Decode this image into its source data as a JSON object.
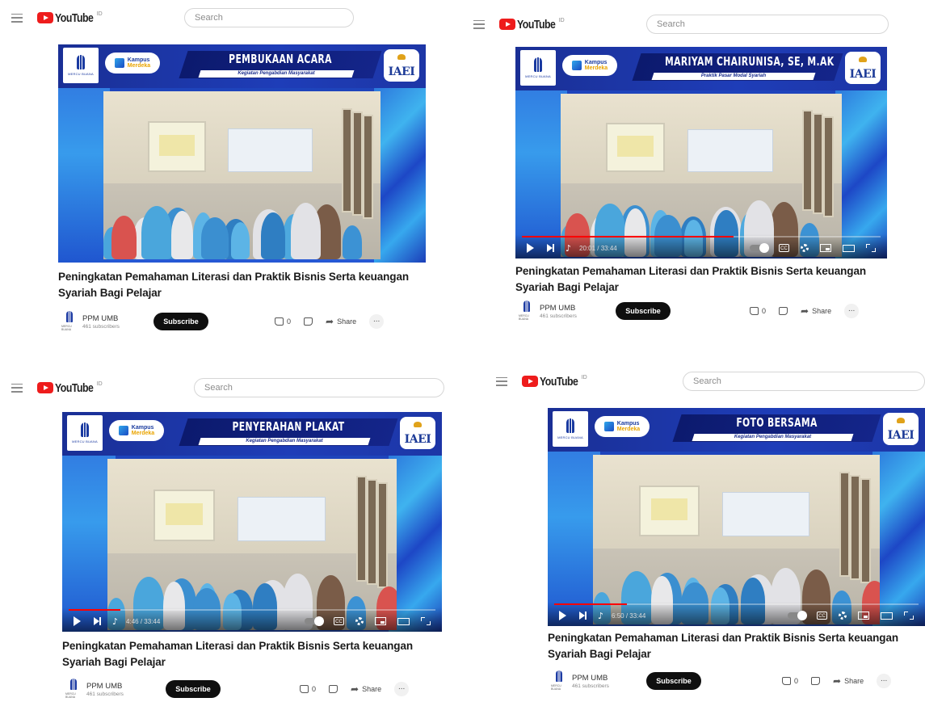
{
  "app": {
    "name": "YouTube",
    "sup": "ID"
  },
  "search": {
    "placeholder": "Search"
  },
  "video": {
    "title": "Peningkatan Pemahaman Literasi dan Praktik Bisnis Serta keuangan Syariah Bagi Pelajar",
    "channel": "PPM UMB",
    "subscribers": "461 subscribers",
    "subscribe_label": "Subscribe",
    "like_count": "0",
    "share_label": "Share",
    "more_label": "..."
  },
  "banner": {
    "kampus_line1": "Kampus",
    "kampus_line2": "Merdeka",
    "subtitle": "Kegiatan Pengabdian Masyarakat",
    "partner_logo": "IAEI",
    "university_caption": "MERCU BUANA"
  },
  "panels": [
    {
      "slide_title": "PEMBUKAAN ACARA",
      "slide_subtitle": "Kegiatan Pengabdian Masyarakat",
      "time": "",
      "progress": 0
    },
    {
      "slide_title": "MARIYAM CHAIRUNISA, SE, M.AK",
      "slide_subtitle": "Praktik Pasar Modal Syariah",
      "time": "20:01 / 33:44",
      "progress": 0.59
    },
    {
      "slide_title": "PENYERAHAN PLAKAT",
      "slide_subtitle": "Kegiatan Pengabdian Masyarakat",
      "time": "4:46 / 33:44",
      "progress": 0.14
    },
    {
      "slide_title": "FOTO BERSAMA",
      "slide_subtitle": "Kegiatan Pengabdian Masyarakat",
      "time": "6:50 / 33:44",
      "progress": 0.2
    }
  ],
  "colors": {
    "youtube_red": "#ee1c1c",
    "banner_blue": "#1e3db8",
    "progress_red": "#ff0000"
  },
  "icons": [
    "menu-icon",
    "youtube-logo-icon",
    "play-icon",
    "next-icon",
    "volume-icon",
    "autoplay-toggle-icon",
    "captions-icon",
    "settings-icon",
    "miniplayer-icon",
    "theater-icon",
    "fullscreen-icon",
    "like-icon",
    "dislike-icon",
    "share-icon",
    "more-icon"
  ]
}
